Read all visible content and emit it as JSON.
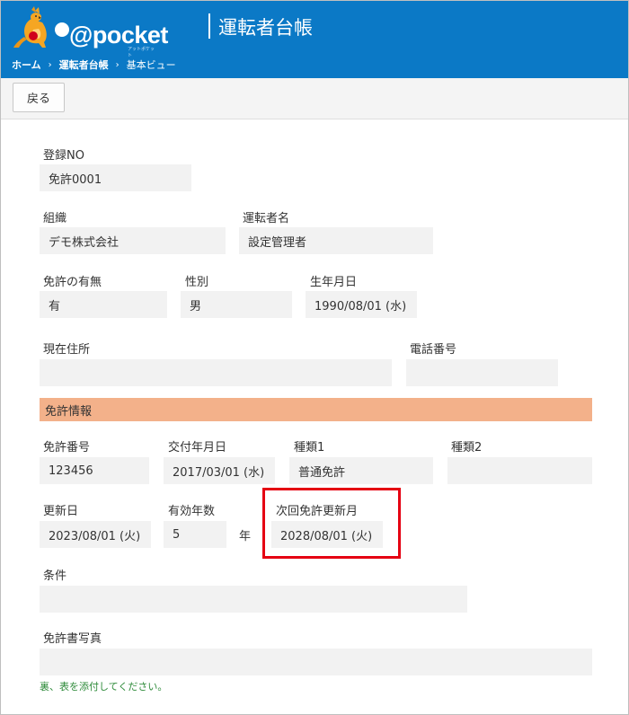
{
  "header": {
    "logo_text": "@pocket",
    "logo_sub": "アットポケット",
    "title": "運転者台帳"
  },
  "breadcrumb": [
    "ホーム",
    "運転者台帳",
    "基本ビュー"
  ],
  "toolbar": {
    "back_label": "戻る"
  },
  "fields": {
    "registration_no": {
      "label": "登録NO",
      "value": "免許0001"
    },
    "organization": {
      "label": "組織",
      "value": "デモ株式会社"
    },
    "driver_name": {
      "label": "運転者名",
      "value": "設定管理者"
    },
    "license_status": {
      "label": "免許の有無",
      "value": "有"
    },
    "gender": {
      "label": "性別",
      "value": "男"
    },
    "birth_date": {
      "label": "生年月日",
      "value": "1990/08/01 (水)"
    },
    "address": {
      "label": "現在住所",
      "value": ""
    },
    "phone": {
      "label": "電話番号",
      "value": ""
    }
  },
  "license_section": {
    "title": "免許情報",
    "license_no": {
      "label": "免許番号",
      "value": "123456"
    },
    "issue_date": {
      "label": "交付年月日",
      "value": "2017/03/01 (水)"
    },
    "type1": {
      "label": "種類1",
      "value": "普通免許"
    },
    "type2": {
      "label": "種類2",
      "value": ""
    },
    "renewal_date": {
      "label": "更新日",
      "value": "2023/08/01 (火)"
    },
    "valid_years": {
      "label": "有効年数",
      "value": "5",
      "unit": "年"
    },
    "next_renewal": {
      "label": "次回免許更新月",
      "value": "2028/08/01 (火)"
    },
    "conditions": {
      "label": "条件",
      "value": ""
    },
    "photo": {
      "label": "免許書写真",
      "value": "",
      "note": "裏、表を添付してください。"
    }
  },
  "colors": {
    "header_bg": "#0b79c6",
    "section_bg": "#f3b18a",
    "highlight": "#e50012",
    "note": "#2e8b3a"
  }
}
